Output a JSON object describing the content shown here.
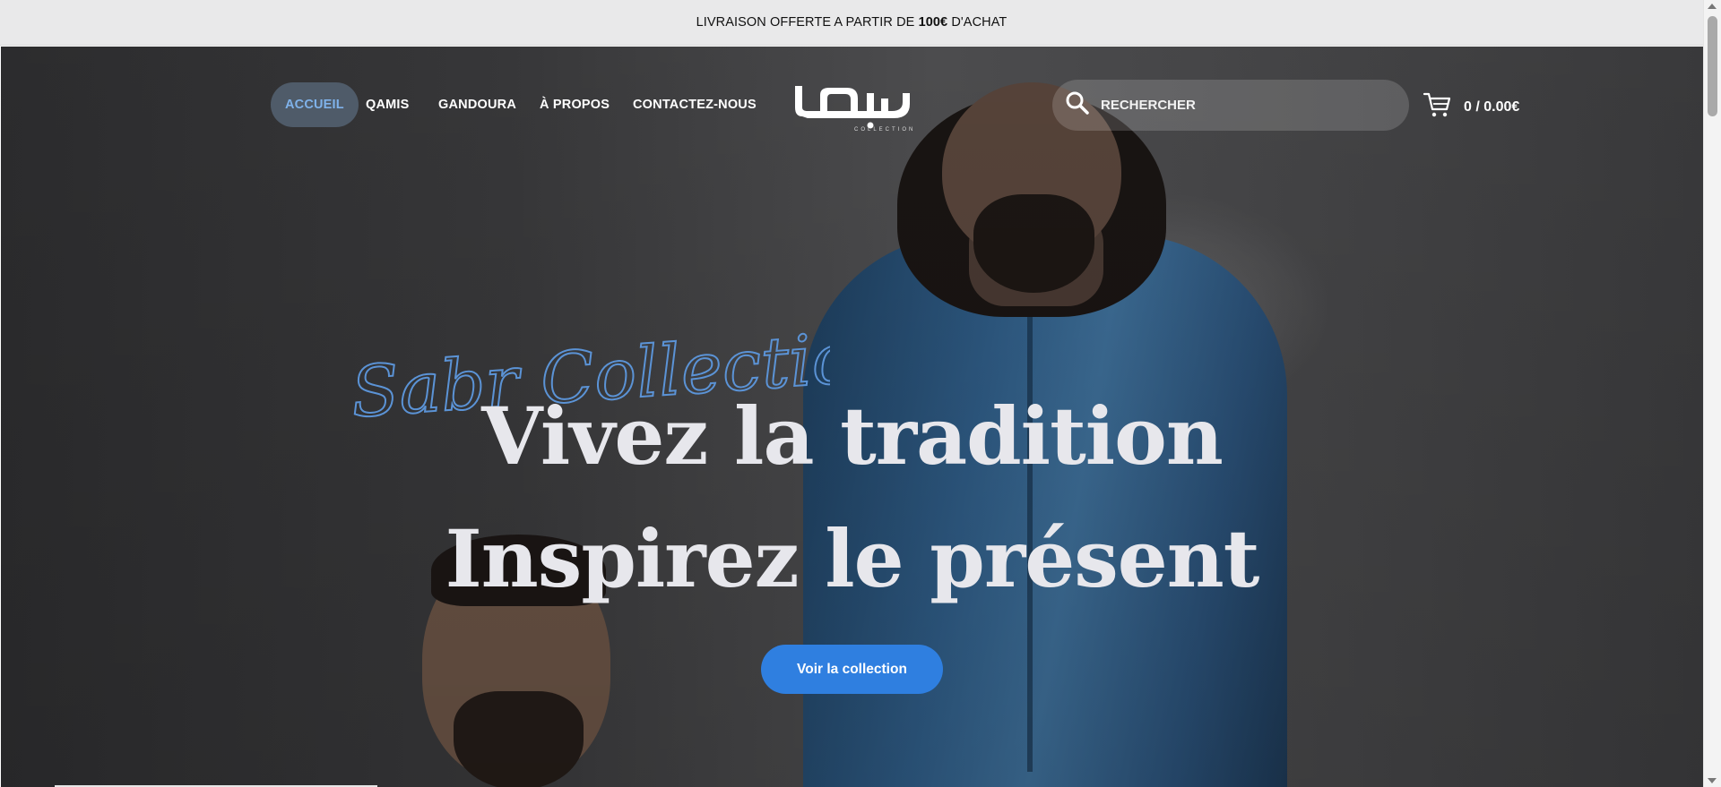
{
  "announcement": {
    "prefix": "LIVRAISON OFFERTE A PARTIR DE ",
    "amount": "100€",
    "suffix": " D'ACHAT"
  },
  "nav": {
    "items": [
      {
        "label": "ACCUEIL",
        "active": true
      },
      {
        "label": "QAMIS",
        "active": false
      },
      {
        "label": "GANDOURA",
        "active": false
      },
      {
        "label": "À PROPOS",
        "active": false
      },
      {
        "label": "CONTACTEZ-NOUS",
        "active": false
      }
    ]
  },
  "logo": {
    "arabic": "صبر",
    "subtitle": "COLLECTION"
  },
  "search": {
    "placeholder": "RECHERCHER",
    "value": ""
  },
  "cart": {
    "total": "0 / 0.00€"
  },
  "hero": {
    "script_title": "Sabr Collection",
    "headline_1": "Vivez la tradition",
    "headline_2": "Inspirez le présent",
    "cta_label": "Voir la collection"
  },
  "colors": {
    "accent": "#2f7fe0",
    "nav_active_text": "#7fb2ea",
    "script_blue": "#5b93d6",
    "announcement_bg": "#e9e9ea"
  },
  "icons": [
    "search-icon",
    "cart-icon"
  ]
}
